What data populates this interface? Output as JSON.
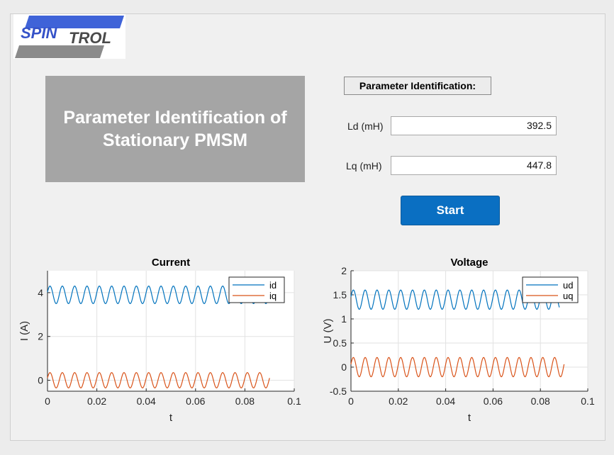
{
  "logo": {
    "text_part1": "SPIN",
    "text_part2": "TROL",
    "colors": {
      "blue": "#3f63d8",
      "gray": "#8b8b8b",
      "text": "#3552c8"
    }
  },
  "title": {
    "line1": "Parameter Identification of",
    "line2": "Stationary PMSM"
  },
  "param_section": {
    "label": "Parameter Identification:"
  },
  "fields": {
    "ld": {
      "label": "Ld (mH)",
      "value": "392.5"
    },
    "lq": {
      "label": "Lq (mH)",
      "value": "447.8"
    }
  },
  "start_button": {
    "label": "Start",
    "color": "#0a6fc2"
  },
  "chart_data": [
    {
      "type": "line",
      "title": "Current",
      "xlabel": "t",
      "ylabel": "I (A)",
      "xlim": [
        0,
        0.1
      ],
      "ylim": [
        -0.5,
        5
      ],
      "xticks": [
        "0",
        "0.02",
        "0.04",
        "0.06",
        "0.08",
        "0.1"
      ],
      "yticks": [
        "0",
        "2",
        "4"
      ],
      "grid": true,
      "legend_position": "top-right",
      "series": [
        {
          "name": "id",
          "color": "#0072bd",
          "offset": 3.9,
          "amplitude": 0.4,
          "frequency": 200,
          "t_end": 0.09
        },
        {
          "name": "iq",
          "color": "#d95319",
          "offset": 0.0,
          "amplitude": 0.35,
          "frequency": 200,
          "t_end": 0.09
        }
      ]
    },
    {
      "type": "line",
      "title": "Voltage",
      "xlabel": "t",
      "ylabel": "U (V)",
      "xlim": [
        0,
        0.1
      ],
      "ylim": [
        -0.5,
        2
      ],
      "xticks": [
        "0",
        "0.02",
        "0.04",
        "0.06",
        "0.08",
        "0.1"
      ],
      "yticks": [
        "-0.5",
        "0",
        "0.5",
        "1",
        "1.5",
        "2"
      ],
      "grid": true,
      "legend_position": "top-right",
      "series": [
        {
          "name": "ud",
          "color": "#0072bd",
          "offset": 1.4,
          "amplitude": 0.2,
          "frequency": 200,
          "t_end": 0.088
        },
        {
          "name": "uq",
          "color": "#d95319",
          "offset": 0.0,
          "amplitude": 0.2,
          "frequency": 200,
          "t_end": 0.09
        }
      ]
    }
  ]
}
